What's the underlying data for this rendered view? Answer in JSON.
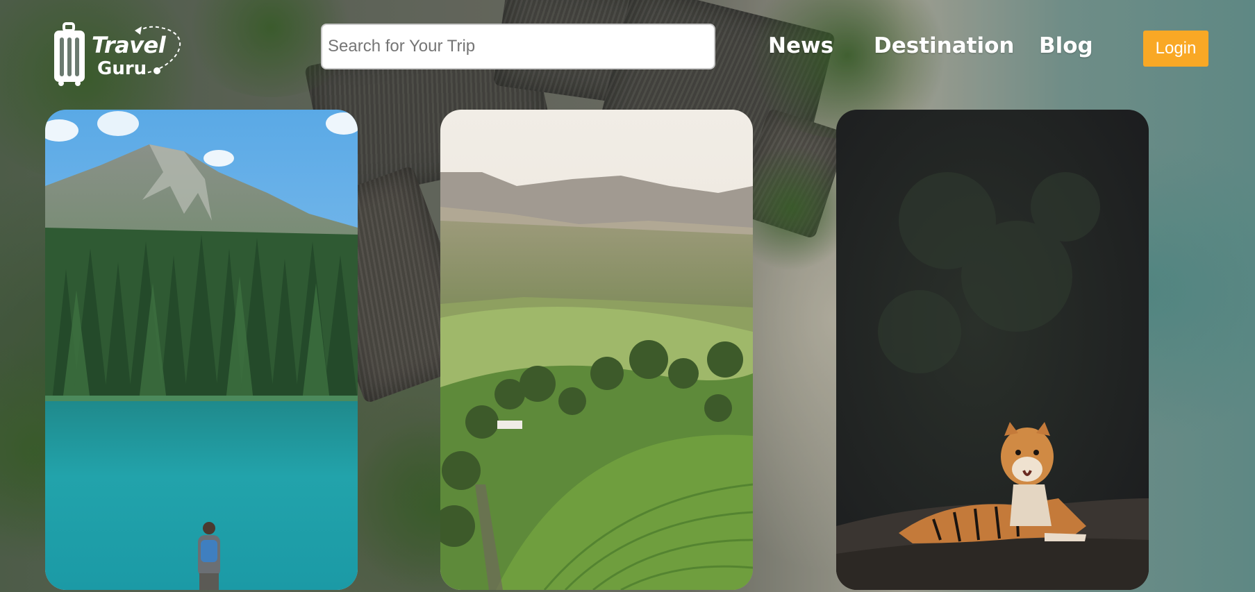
{
  "header": {
    "logo": {
      "line1": "Travel",
      "line2": "Guru"
    },
    "search": {
      "placeholder": "Search for Your Trip",
      "value": ""
    },
    "nav": [
      {
        "label": "News"
      },
      {
        "label": "Destination"
      },
      {
        "label": "Blog"
      }
    ],
    "login_label": "Login"
  },
  "colors": {
    "accent": "#f9a825",
    "nav_text": "#ffffff"
  },
  "cards": [
    {
      "icon": "mountain-lake-photo"
    },
    {
      "icon": "hills-tea-plantation-photo"
    },
    {
      "icon": "tiger-forest-photo"
    }
  ]
}
